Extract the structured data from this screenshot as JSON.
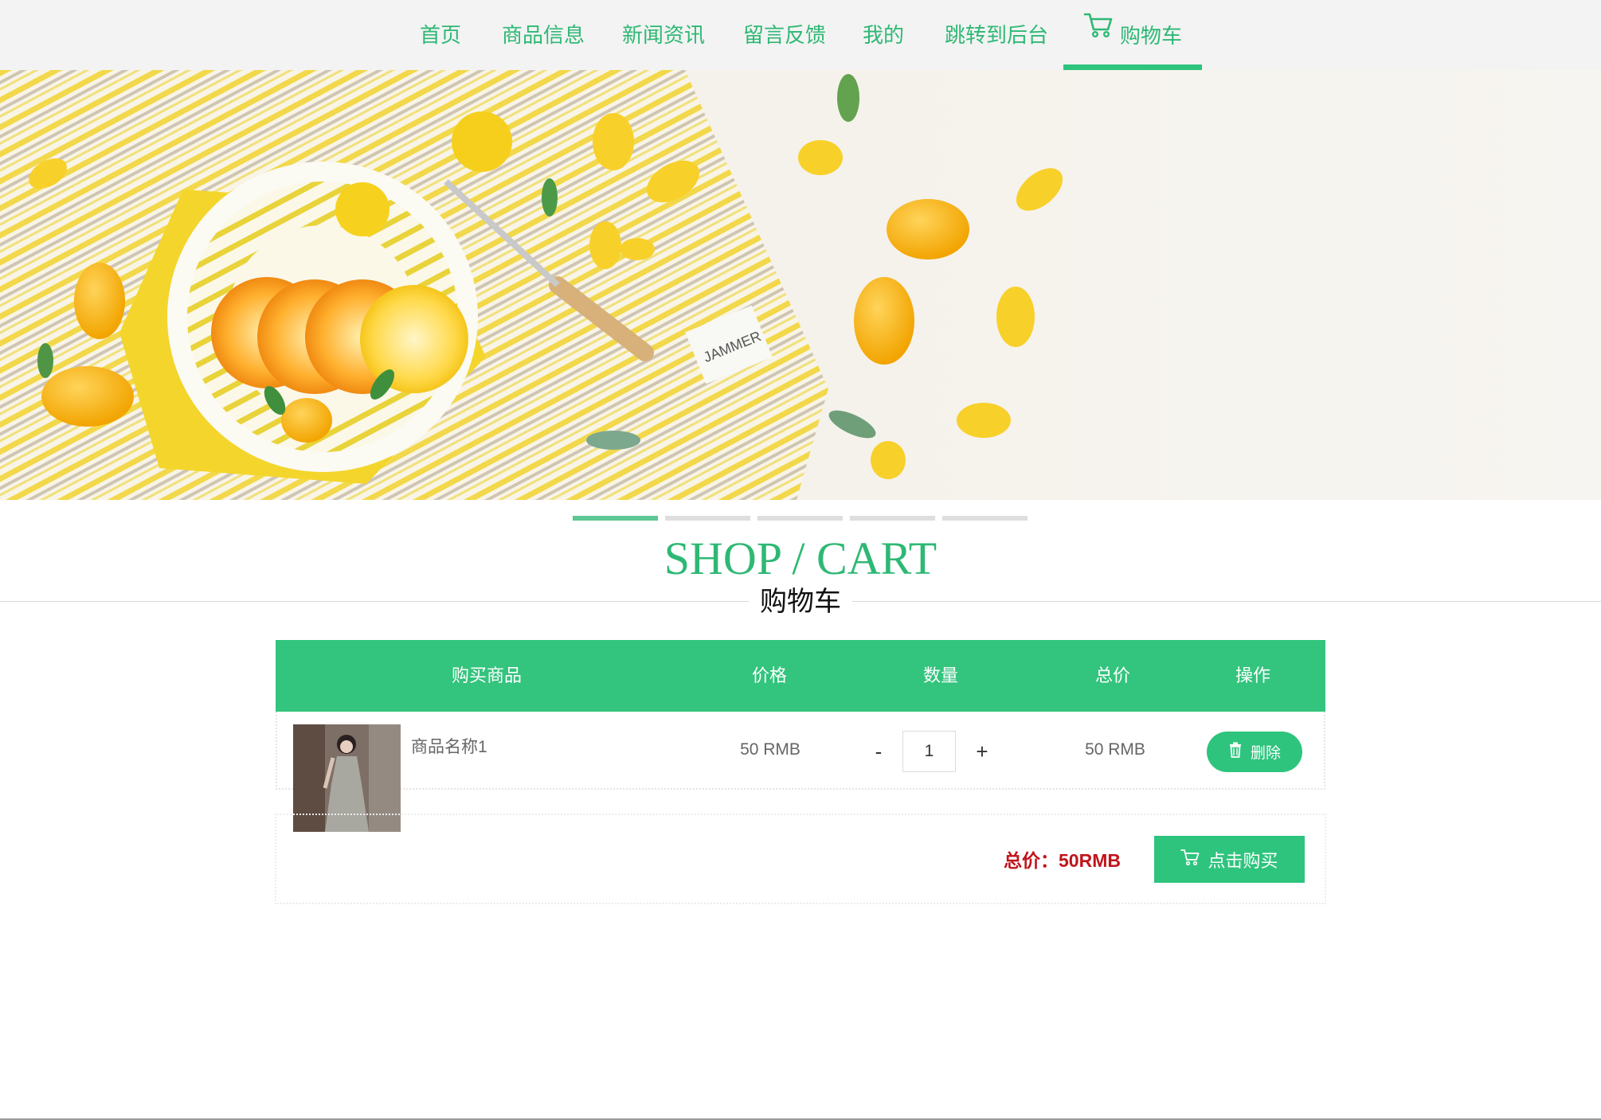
{
  "nav": {
    "items": [
      {
        "label": "首页"
      },
      {
        "label": "商品信息"
      },
      {
        "label": "新闻资讯"
      },
      {
        "label": "留言反馈"
      },
      {
        "label": "我的"
      },
      {
        "label": "跳转到后台"
      },
      {
        "label": "购物车",
        "icon": "cart-icon",
        "active": true
      }
    ]
  },
  "banner": {
    "slides_total": 5,
    "active_slide": 1,
    "label_text": "JAMMER"
  },
  "section": {
    "title_en": "SHOP / CART",
    "title_cn": "购物车"
  },
  "table": {
    "headers": [
      "购买商品",
      "价格",
      "数量",
      "总价",
      "操作"
    ],
    "rows": [
      {
        "name": "商品名称1",
        "price": "50 RMB",
        "qty": "1",
        "minus": "-",
        "plus": "+",
        "total": "50 RMB",
        "delete_label": "删除",
        "delete_icon": "trash-icon"
      }
    ]
  },
  "summary": {
    "total_text": "总价：50RMB",
    "buy_label": "点击购买",
    "buy_icon": "cart-icon"
  },
  "colors": {
    "accent": "#2ec47d",
    "header_bg": "#33c47d",
    "nav_text": "#2eb874",
    "nav_bg": "#f3f3f3",
    "total_red": "#c0141b"
  }
}
